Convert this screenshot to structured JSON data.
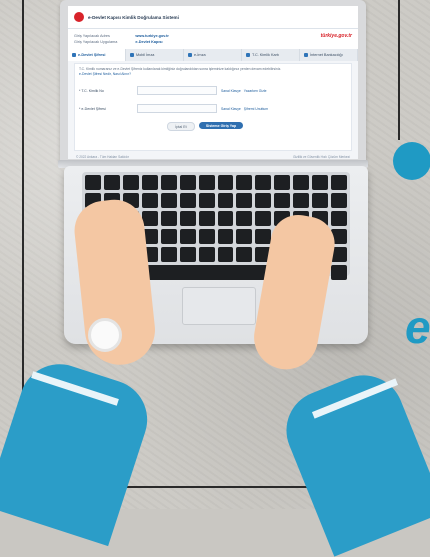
{
  "colors": {
    "accent": "#1f9ac4",
    "brand_red": "#d8232a",
    "link_blue": "#1c5c9c"
  },
  "screen": {
    "header_title": "e-Devlet Kapısı Kimlik Doğrulama Sistemi",
    "info": {
      "label_1": "Giriş Yapılacak Adres",
      "label_2": "Giriş Yapılacak Uygulama",
      "value_1": "www.turkiye.gov.tr",
      "value_2": "e-Devlet Kapısı",
      "brand": "türkiye.gov.tr"
    },
    "tabs": [
      "e-Devlet Şifresi",
      "Mobil İmza",
      "e-İmza",
      "T.C. Kimlik Kartı",
      "İnternet Bankacılığı"
    ],
    "description": "T.C. Kimlik numaranız ve e-Devlet Şifreniz kullanılarak kimliğiniz doğrulandıktan sonra işleminize kaldığınız yerden devam edebilirsiniz.",
    "description_link": "e-Devlet Şifresi Nedir, Nasıl Alınır?",
    "field_tc_label": "* T.C. Kimlik No",
    "field_pw_label": "* e-Devlet Şifresi",
    "aux_keyboard": "Sanal Klavye",
    "aux_tc_help": "Yazarken Gizle",
    "aux_pw_help": "Şifremi Unuttum",
    "cancel_label": "İptal Et",
    "login_label": "Sisteme Giriş Yap",
    "footer_left": "© 2022 Ankara - Tüm Hakları Saklıdır",
    "footer_right": "Gizlilik ve Güvenlik   Hızlı Çözüm Merkezi"
  },
  "side_letter": "e"
}
